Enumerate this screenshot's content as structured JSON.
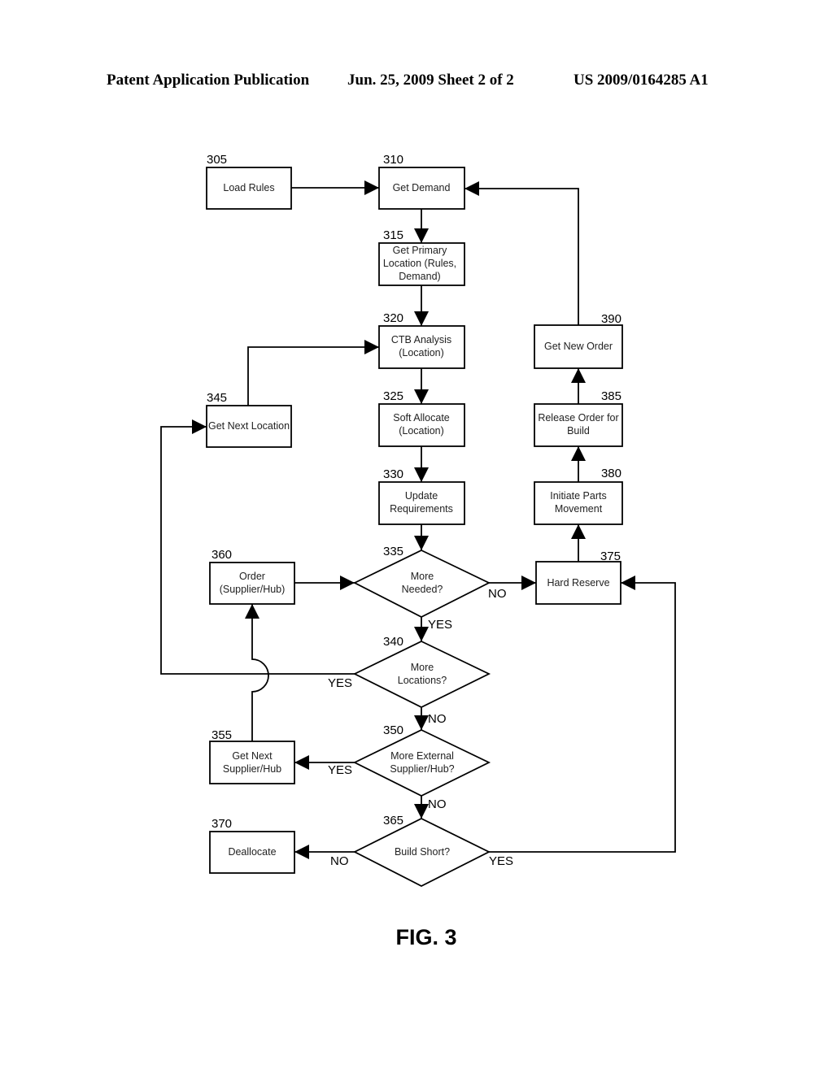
{
  "header": {
    "left": "Patent Application Publication",
    "middle": "Jun. 25, 2009  Sheet 2 of 2",
    "right": "US 2009/0164285 A1"
  },
  "figure_label": "FIG. 3",
  "nodes": {
    "n305": {
      "ref": "305",
      "lines": [
        "Load Rules"
      ]
    },
    "n310": {
      "ref": "310",
      "lines": [
        "Get Demand"
      ]
    },
    "n315": {
      "ref": "315",
      "lines": [
        "Get Primary",
        "Location (Rules,",
        "Demand)"
      ]
    },
    "n320": {
      "ref": "320",
      "lines": [
        "CTB Analysis",
        "(Location)"
      ]
    },
    "n325": {
      "ref": "325",
      "lines": [
        "Soft Allocate",
        "(Location)"
      ]
    },
    "n330": {
      "ref": "330",
      "lines": [
        "Update",
        "Requirements"
      ]
    },
    "n335": {
      "ref": "335",
      "lines": [
        "More",
        "Needed?"
      ]
    },
    "n340": {
      "ref": "340",
      "lines": [
        "More",
        "Locations?"
      ]
    },
    "n345": {
      "ref": "345",
      "lines": [
        "Get Next Location"
      ]
    },
    "n350": {
      "ref": "350",
      "lines": [
        "More External",
        "Supplier/Hub?"
      ]
    },
    "n355": {
      "ref": "355",
      "lines": [
        "Get Next",
        "Supplier/Hub"
      ]
    },
    "n360": {
      "ref": "360",
      "lines": [
        "Order",
        "(Supplier/Hub)"
      ]
    },
    "n365": {
      "ref": "365",
      "lines": [
        "Build Short?"
      ]
    },
    "n370": {
      "ref": "370",
      "lines": [
        "Deallocate"
      ]
    },
    "n375": {
      "ref": "375",
      "lines": [
        "Hard Reserve"
      ]
    },
    "n380": {
      "ref": "380",
      "lines": [
        "Initiate Parts",
        "Movement"
      ]
    },
    "n385": {
      "ref": "385",
      "lines": [
        "Release Order for",
        "Build"
      ]
    },
    "n390": {
      "ref": "390",
      "lines": [
        "Get New Order"
      ]
    }
  },
  "edge_labels": {
    "e335_no": "NO",
    "e335_yes": "YES",
    "e340_yes": "YES",
    "e340_no": "NO",
    "e350_yes": "YES",
    "e350_no": "NO",
    "e365_no": "NO",
    "e365_yes": "YES"
  }
}
